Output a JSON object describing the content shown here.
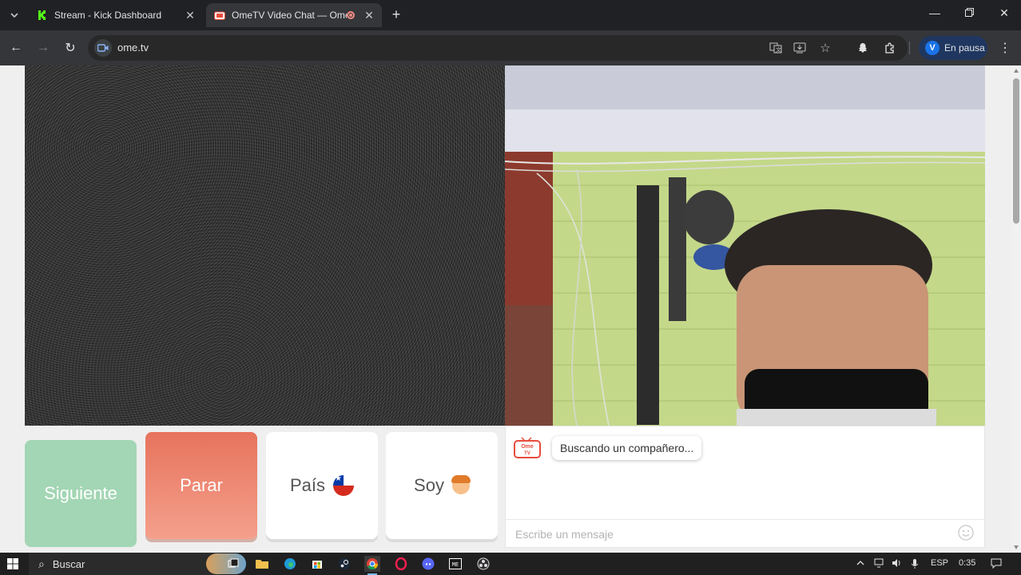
{
  "browser": {
    "tabs": [
      {
        "title": "Stream - Kick Dashboard",
        "favicon": "kick-icon",
        "active": false
      },
      {
        "title": "OmeTV Video Chat — Ome",
        "favicon": "ometv-icon",
        "active": true
      }
    ],
    "url": "ome.tv",
    "profile_initial": "V",
    "profile_label": "En pausa"
  },
  "buttons": {
    "next": "Siguiente",
    "stop": "Parar",
    "country": "País",
    "soy": "Soy"
  },
  "chat": {
    "status_message": "Buscando un compañero...",
    "input_placeholder": "Escribe un mensaje",
    "logo_text_top": "Ome",
    "logo_text_bottom": "TV"
  },
  "taskbar": {
    "search_placeholder": "Buscar",
    "language": "ESP",
    "time": "0:35"
  },
  "colors": {
    "next_button": "#a3d6b4",
    "stop_button": "#e7735d",
    "accent": "#1a73e8"
  }
}
